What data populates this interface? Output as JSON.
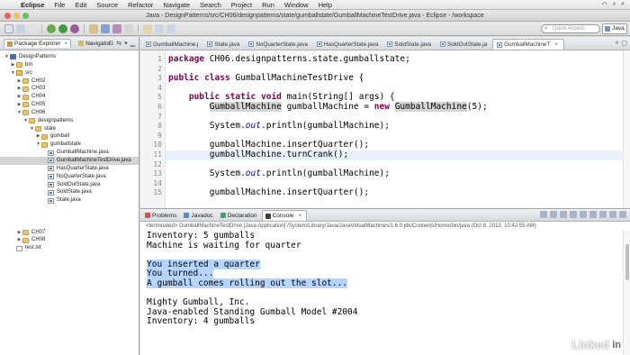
{
  "menubar": {
    "app": "Eclipse",
    "items": [
      "File",
      "Edit",
      "Source",
      "Refactor",
      "Navigate",
      "Search",
      "Project",
      "Run",
      "Window",
      "Help"
    ]
  },
  "window": {
    "title": "Java - DesignPatterns/src/CH06/designpatterns/state/gumballstate/GumballMachineTestDrive.java - Eclipse - /workspace"
  },
  "toolbar": {
    "quick_access_placeholder": "Quick Access",
    "perspective": "Java"
  },
  "left_panel": {
    "tabs": [
      "Package Explorer",
      "Navigator"
    ],
    "tree": [
      {
        "label": "DesignPatterns",
        "icon": "project-icon",
        "indent": 0,
        "expanded": true
      },
      {
        "label": "bin",
        "icon": "folder-icon",
        "indent": 1,
        "expanded": false
      },
      {
        "label": "src",
        "icon": "source-folder-icon",
        "indent": 1,
        "expanded": true
      },
      {
        "label": "CH02",
        "icon": "folder-icon",
        "indent": 2,
        "expanded": false
      },
      {
        "label": "CH03",
        "icon": "folder-icon",
        "indent": 2,
        "expanded": false
      },
      {
        "label": "CH04",
        "icon": "folder-icon",
        "indent": 2,
        "expanded": false
      },
      {
        "label": "CH05",
        "icon": "folder-icon",
        "indent": 2,
        "expanded": false
      },
      {
        "label": "CH06",
        "icon": "folder-icon",
        "indent": 2,
        "expanded": true
      },
      {
        "label": "designpatterns",
        "icon": "folder-icon",
        "indent": 3,
        "expanded": true
      },
      {
        "label": "state",
        "icon": "folder-icon",
        "indent": 4,
        "expanded": true
      },
      {
        "label": "gumball",
        "icon": "folder-icon",
        "indent": 5,
        "expanded": false
      },
      {
        "label": "gumballstate",
        "icon": "folder-icon",
        "indent": 5,
        "expanded": true
      },
      {
        "label": "GumballMachine.java",
        "icon": "java-file-icon",
        "indent": 6,
        "expanded": null
      },
      {
        "label": "GumballMachineTestDrive.java",
        "icon": "java-file-icon",
        "indent": 6,
        "expanded": null,
        "selected": true
      },
      {
        "label": "HasQuarterState.java",
        "icon": "java-file-icon",
        "indent": 6,
        "expanded": null
      },
      {
        "label": "NoQuarterState.java",
        "icon": "java-file-icon",
        "indent": 6,
        "expanded": null
      },
      {
        "label": "SoldOutState.java",
        "icon": "java-file-icon",
        "indent": 6,
        "expanded": null
      },
      {
        "label": "SoldState.java",
        "icon": "java-file-icon",
        "indent": 6,
        "expanded": null
      },
      {
        "label": "State.java",
        "icon": "java-file-icon",
        "indent": 6,
        "expanded": null
      },
      {
        "label": "",
        "icon": "",
        "indent": 0,
        "expanded": null
      },
      {
        "label": "",
        "icon": "",
        "indent": 0,
        "expanded": null
      },
      {
        "label": "",
        "icon": "",
        "indent": 0,
        "expanded": null
      },
      {
        "label": "CH07",
        "icon": "folder-icon",
        "indent": 2,
        "expanded": false
      },
      {
        "label": "CH08",
        "icon": "folder-icon",
        "indent": 2,
        "expanded": false
      },
      {
        "label": "test.txt",
        "icon": "text-file-icon",
        "indent": 1,
        "expanded": null
      }
    ]
  },
  "editor": {
    "tabs": [
      {
        "label": "GumballMachine.j",
        "active": false
      },
      {
        "label": "State.java",
        "active": false
      },
      {
        "label": "NoQuarterState.java",
        "active": false
      },
      {
        "label": "HasQuarterState.java",
        "active": false
      },
      {
        "label": "SoldState.java",
        "active": false
      },
      {
        "label": "SoldOutState.ja",
        "active": false
      },
      {
        "label": "GumballMachineT",
        "active": true
      }
    ],
    "line_numbers": [
      "1",
      "2",
      "3",
      "4",
      "5",
      "6",
      "7",
      "8",
      "9",
      "10",
      "11",
      "12",
      "13",
      "14",
      "15"
    ],
    "lines": [
      "package CH06.designpatterns.state.gumballstate;",
      "",
      "public class GumballMachineTestDrive {",
      "",
      "    public static void main(String[] args) {",
      "        GumballMachine gumballMachine = new GumballMachine(5);",
      "",
      "        System.out.println(gumballMachine);",
      "",
      "        gumballMachine.insertQuarter();",
      "        gumballMachine.turnCrank();",
      "",
      "        System.out.println(gumballMachine);",
      "",
      "        gumballMachine.insertQuarter();"
    ],
    "current_line": 11
  },
  "console": {
    "tabs": [
      {
        "label": "Problems",
        "active": false
      },
      {
        "label": "Javadoc",
        "active": false
      },
      {
        "label": "Declaration",
        "active": false
      },
      {
        "label": "Console",
        "active": true
      }
    ],
    "header": "<terminated> GumballMachineTestDrive [Java Application] /System/Library/Java/JavaVirtualMachines/1.6.0.jdk/Contents/Home/bin/java (Oct 8, 2013, 10:42:55 AM)",
    "output": [
      {
        "text": "Inventory: 5 gumballs",
        "selected": false
      },
      {
        "text": "Machine is waiting for quarter",
        "selected": false
      },
      {
        "text": "",
        "selected": false
      },
      {
        "text": "You inserted a quarter",
        "selected": true
      },
      {
        "text": "You turned...",
        "selected": true
      },
      {
        "text": "A gumball comes rolling out the slot...",
        "selected": true
      },
      {
        "text": "",
        "selected": false
      },
      {
        "text": "Mighty Gumball, Inc.",
        "selected": false
      },
      {
        "text": "Java-enabled Standing Gumball Model #2004",
        "selected": false
      },
      {
        "text": "Inventory: 4 gumballs",
        "selected": false
      }
    ]
  },
  "watermark": {
    "text": "Linked",
    "suffix": "in"
  }
}
